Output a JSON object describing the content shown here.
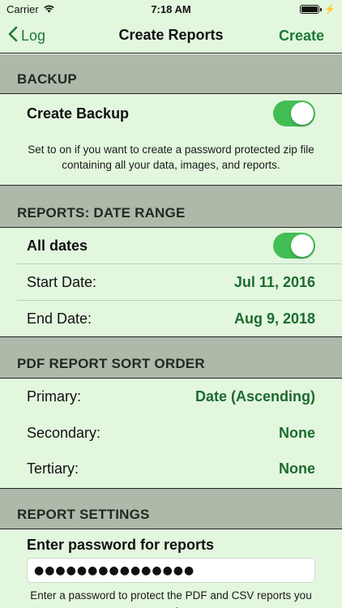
{
  "status_bar": {
    "carrier": "Carrier",
    "time": "7:18 AM"
  },
  "nav": {
    "back_label": "Log",
    "title": "Create Reports",
    "action_label": "Create"
  },
  "backup": {
    "header": "BACKUP",
    "toggle_label": "Create Backup",
    "toggle_on": true,
    "note": "Set to on if you want to create a password protected zip file containing all your data, images, and reports."
  },
  "date_range": {
    "header": "REPORTS:  DATE RANGE",
    "all_dates_label": "All dates",
    "all_dates_on": true,
    "start_label": "Start Date:",
    "start_value": "Jul 11, 2016",
    "end_label": "End Date:",
    "end_value": "Aug 9, 2018"
  },
  "sort_order": {
    "header": "PDF REPORT SORT ORDER",
    "primary_label": "Primary:",
    "primary_value": "Date (Ascending)",
    "secondary_label": "Secondary:",
    "secondary_value": "None",
    "tertiary_label": "Tertiary:",
    "tertiary_value": "None"
  },
  "report_settings": {
    "header": "REPORT SETTINGS",
    "password_label": "Enter password for reports",
    "password_value": "●●●●●●●●●●●●●●●",
    "note": "Enter a password to protect the PDF and CSV reports you create."
  }
}
